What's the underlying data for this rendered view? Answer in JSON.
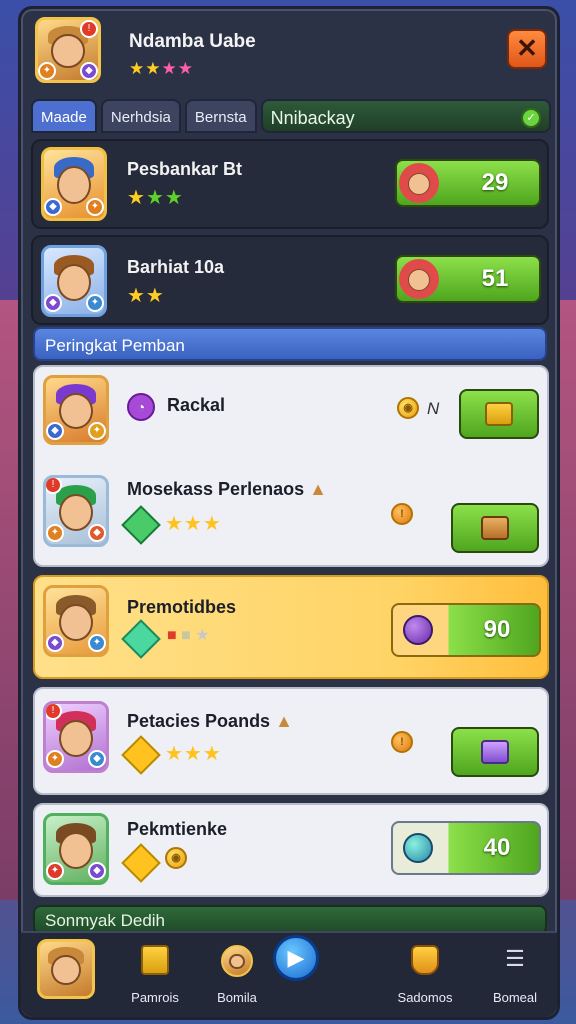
{
  "header": {
    "player_name": "Ndamba Uabe",
    "stars": "★★★★",
    "close_label": "✕"
  },
  "tabs": [
    {
      "label": "Maade"
    },
    {
      "label": "Nerhdsia"
    },
    {
      "label": "Bernsta"
    },
    {
      "label": "Nnibackay"
    }
  ],
  "top_rows": [
    {
      "name": "Pesbankar Bt",
      "stars": "★★★",
      "value": "29"
    },
    {
      "name": "Barhiat 10a",
      "stars": "★★",
      "value": "51"
    }
  ],
  "section_title": "Peringkat Pemban",
  "cards": [
    {
      "name": "Rackal",
      "side_text": "N",
      "stars": ""
    },
    {
      "name": "Mosekass Perlenaos",
      "stars": "★★★"
    },
    {
      "name": "Premotidbes",
      "stars": "",
      "value": "90"
    },
    {
      "name": "Petacies Poands",
      "stars": "★★★"
    },
    {
      "name": "Pekmtienke",
      "stars": "",
      "value": "40"
    }
  ],
  "footer_bar": "Sonmyak Dedih",
  "nav": [
    {
      "label": ""
    },
    {
      "label": "Pamrois"
    },
    {
      "label": "Bomila"
    },
    {
      "label": ""
    },
    {
      "label": "Sadomos"
    },
    {
      "label": "Bomeal"
    }
  ],
  "colors": {
    "accent_green": "#5fbf2a",
    "gold_highlight": "#ffd466",
    "tab_active": "#4d6fd0",
    "close_orange": "#ff7a2e"
  }
}
